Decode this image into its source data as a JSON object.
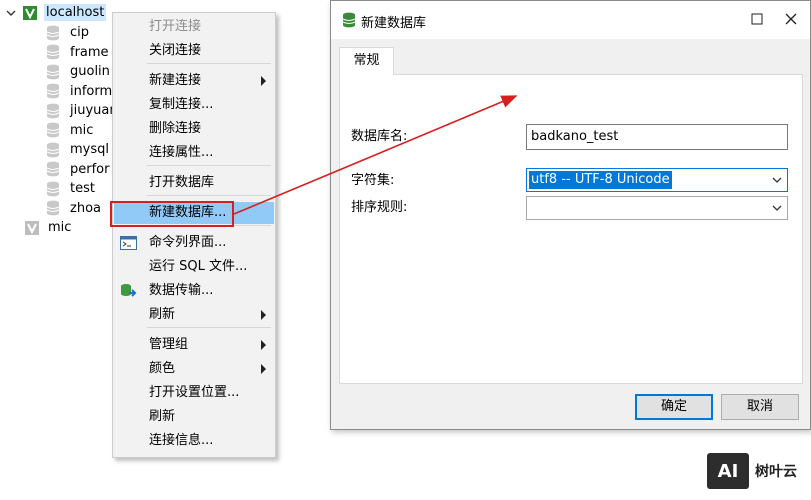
{
  "tree": {
    "connection": "localhost",
    "databases": [
      "cip",
      "frame",
      "guolin",
      "inform",
      "jiuyuan",
      "mic",
      "mysql",
      "perfor",
      "test",
      "zhoa"
    ],
    "other_connection": "mic"
  },
  "context_menu": {
    "items": [
      {
        "label": "打开连接",
        "disabled": true
      },
      {
        "label": "关闭连接"
      },
      {
        "label": "新建连接",
        "submenu": true
      },
      {
        "label": "复制连接..."
      },
      {
        "label": "删除连接"
      },
      {
        "label": "连接属性..."
      },
      {
        "label": "打开数据库"
      },
      {
        "label": "新建数据库...",
        "highlight": true
      },
      {
        "label": "命令列界面...",
        "icon": "terminal-icon"
      },
      {
        "label": "运行 SQL 文件..."
      },
      {
        "label": "数据传输...",
        "icon": "data-transfer-icon"
      },
      {
        "label": "刷新",
        "submenu": true
      },
      {
        "label": "管理组",
        "submenu": true
      },
      {
        "label": "颜色",
        "submenu": true
      },
      {
        "label": "打开设置位置..."
      },
      {
        "label": "刷新"
      },
      {
        "label": "连接信息..."
      }
    ]
  },
  "dialog": {
    "title": "新建数据库",
    "tab": "常规",
    "db_name_label": "数据库名:",
    "db_name_value": "badkano_test",
    "charset_label": "字符集:",
    "charset_value": "utf8 -- UTF-8 Unicode",
    "collation_label": "排序规则:",
    "collation_value": "",
    "ok_button": "确定",
    "cancel_button": "取消"
  },
  "watermark": {
    "logo": "AI",
    "text": "树叶云"
  },
  "colors": {
    "accent": "#0078d7",
    "annotation_red": "#d81e1e",
    "menu_highlight": "#91c9f7"
  }
}
